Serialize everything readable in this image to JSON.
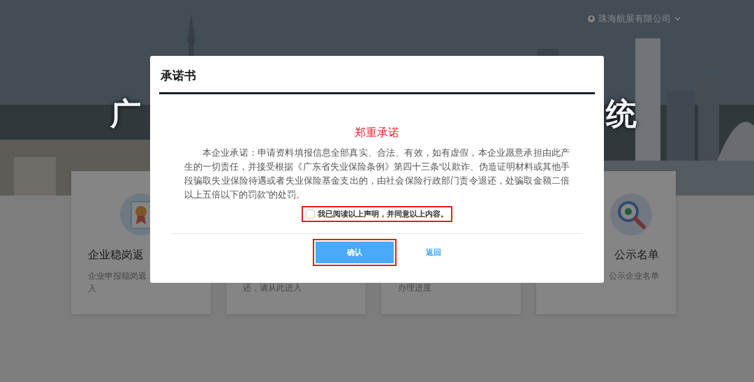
{
  "header": {
    "user": "珠海航展有限公司"
  },
  "banner": {
    "title_fragments": [
      "广",
      "统"
    ]
  },
  "cards": [
    {
      "title": "企业稳岗返",
      "description": [
        "企业申报稳岗返",
        "入"
      ]
    },
    {
      "description": [
        "还，请从此进入"
      ]
    },
    {
      "description": [
        "办理进度"
      ]
    },
    {
      "title": "公示名单",
      "description": [
        "公示企业名单"
      ]
    }
  ],
  "modal": {
    "title": "承诺书",
    "heading": "郑重承诺",
    "body": "本企业承诺：申请资料填报信息全部真实、合法、有效，如有虚假，本企业愿意承担由此产生的一切责任，并接受根据《广东省失业保险条例》第四十三条“以欺诈、伪造证明材料或其他手段骗取失业保险待遇或者失业保险基金支出的，由社会保险行政部门责令退还，处骗取金额二倍以上五倍以下的罚款”的处罚。",
    "agreement": {
      "label": "我已阅读以上声明，并同意以上内容。",
      "checked": false
    },
    "buttons": [
      {
        "label": "确认",
        "kind": "primary"
      },
      {
        "label": "返回",
        "kind": "link"
      }
    ]
  }
}
